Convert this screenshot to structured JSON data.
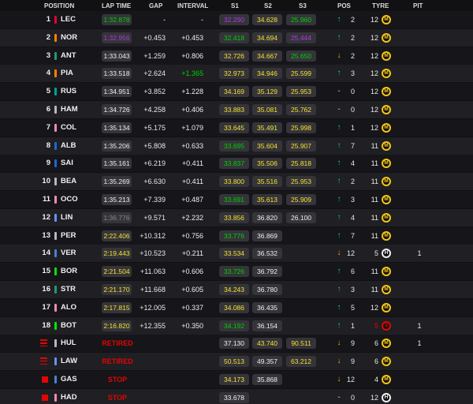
{
  "header": {
    "position": "POSITION",
    "lap_time": "LAP TIME",
    "gap": "GAP",
    "interval": "INTERVAL",
    "s1": "S1",
    "s2": "S2",
    "s3": "S3",
    "pos": "POS",
    "tyre": "TYRE",
    "pit": "PIT"
  },
  "colors": {
    "purple": "#b138dd",
    "green": "#00d000",
    "yellow": "#f5e02e",
    "white": "#f0f0f0",
    "grey": "#8a8a8a",
    "red": "#e10600",
    "arrow_up": "#22c55e",
    "arrow_down": "#f5a623"
  },
  "rows": [
    {
      "pos": "1",
      "status_icon": "",
      "team_color": "#e8002d",
      "code": "LEC",
      "lap_time": "1:32.878",
      "lap_color": "green",
      "status": "",
      "gap": "-",
      "interval": "-",
      "interval_color": "white",
      "s1": "32.290",
      "s1c": "purple",
      "s2": "34.628",
      "s2c": "yellow",
      "s3": "25.960",
      "s3c": "green",
      "arrow": "up",
      "pos_change": "2",
      "tyre_age": "12",
      "tyre_compound": "M",
      "tyre_color": "#f5c518",
      "pit": ""
    },
    {
      "pos": "2",
      "status_icon": "",
      "team_color": "#ff8000",
      "code": "NOR",
      "lap_time": "1:32.956",
      "lap_color": "purple",
      "status": "",
      "gap": "+0.453",
      "interval": "+0.453",
      "interval_color": "white",
      "s1": "32.418",
      "s1c": "green",
      "s2": "34.694",
      "s2c": "yellow",
      "s3": "25.444",
      "s3c": "purple",
      "arrow": "up",
      "pos_change": "2",
      "tyre_age": "12",
      "tyre_compound": "M",
      "tyre_color": "#f5c518",
      "pit": ""
    },
    {
      "pos": "3",
      "status_icon": "",
      "team_color": "#229971",
      "code": "ANT",
      "lap_time": "1:33.043",
      "lap_color": "white",
      "status": "",
      "gap": "+1.259",
      "interval": "+0.806",
      "interval_color": "white",
      "s1": "32.726",
      "s1c": "yellow",
      "s2": "34.667",
      "s2c": "yellow",
      "s3": "25.650",
      "s3c": "green",
      "arrow": "down",
      "pos_change": "2",
      "tyre_age": "12",
      "tyre_compound": "M",
      "tyre_color": "#f5c518",
      "pit": ""
    },
    {
      "pos": "4",
      "status_icon": "",
      "team_color": "#ff8000",
      "code": "PIA",
      "lap_time": "1:33.518",
      "lap_color": "white",
      "status": "",
      "gap": "+2.624",
      "interval": "+1.365",
      "interval_color": "green",
      "s1": "32.973",
      "s1c": "yellow",
      "s2": "34.946",
      "s2c": "yellow",
      "s3": "25.599",
      "s3c": "yellow",
      "arrow": "up",
      "pos_change": "3",
      "tyre_age": "12",
      "tyre_compound": "M",
      "tyre_color": "#f5c518",
      "pit": ""
    },
    {
      "pos": "5",
      "status_icon": "",
      "team_color": "#00a19c",
      "code": "RUS",
      "lap_time": "1:34.951",
      "lap_color": "white",
      "status": "",
      "gap": "+3.852",
      "interval": "+1.228",
      "interval_color": "white",
      "s1": "34.169",
      "s1c": "yellow",
      "s2": "35.129",
      "s2c": "yellow",
      "s3": "25.953",
      "s3c": "yellow",
      "arrow": "same",
      "pos_change": "0",
      "tyre_age": "12",
      "tyre_compound": "M",
      "tyre_color": "#f5c518",
      "pit": ""
    },
    {
      "pos": "6",
      "status_icon": "",
      "team_color": "#b6babd",
      "code": "HAM",
      "lap_time": "1:34.726",
      "lap_color": "white",
      "status": "",
      "gap": "+4.258",
      "interval": "+0.406",
      "interval_color": "white",
      "s1": "33.883",
      "s1c": "yellow",
      "s2": "35.081",
      "s2c": "yellow",
      "s3": "25.762",
      "s3c": "yellow",
      "arrow": "same",
      "pos_change": "0",
      "tyre_age": "12",
      "tyre_compound": "M",
      "tyre_color": "#f5c518",
      "pit": ""
    },
    {
      "pos": "7",
      "status_icon": "",
      "team_color": "#ff87bc",
      "code": "COL",
      "lap_time": "1:35.134",
      "lap_color": "white",
      "status": "",
      "gap": "+5.175",
      "interval": "+1.079",
      "interval_color": "white",
      "s1": "33.645",
      "s1c": "yellow",
      "s2": "35.491",
      "s2c": "yellow",
      "s3": "25.998",
      "s3c": "yellow",
      "arrow": "up",
      "pos_change": "1",
      "tyre_age": "12",
      "tyre_compound": "M",
      "tyre_color": "#f5c518",
      "pit": ""
    },
    {
      "pos": "8",
      "status_icon": "",
      "team_color": "#1868db",
      "code": "ALB",
      "lap_time": "1:35.206",
      "lap_color": "white",
      "status": "",
      "gap": "+5.808",
      "interval": "+0.633",
      "interval_color": "white",
      "s1": "33.695",
      "s1c": "green",
      "s2": "35.604",
      "s2c": "yellow",
      "s3": "25.907",
      "s3c": "yellow",
      "arrow": "up",
      "pos_change": "7",
      "tyre_age": "11",
      "tyre_compound": "M",
      "tyre_color": "#f5c518",
      "pit": ""
    },
    {
      "pos": "9",
      "status_icon": "",
      "team_color": "#1868db",
      "code": "SAI",
      "lap_time": "1:35.161",
      "lap_color": "white",
      "status": "",
      "gap": "+6.219",
      "interval": "+0.411",
      "interval_color": "white",
      "s1": "33.837",
      "s1c": "green",
      "s2": "35.506",
      "s2c": "yellow",
      "s3": "25.818",
      "s3c": "yellow",
      "arrow": "up",
      "pos_change": "4",
      "tyre_age": "11",
      "tyre_compound": "M",
      "tyre_color": "#f5c518",
      "pit": ""
    },
    {
      "pos": "10",
      "status_icon": "",
      "team_color": "#b6babd",
      "code": "BEA",
      "lap_time": "1:35.269",
      "lap_color": "white",
      "status": "",
      "gap": "+6.630",
      "interval": "+0.411",
      "interval_color": "white",
      "s1": "33.800",
      "s1c": "yellow",
      "s2": "35.516",
      "s2c": "yellow",
      "s3": "25.953",
      "s3c": "yellow",
      "arrow": "up",
      "pos_change": "2",
      "tyre_age": "11",
      "tyre_compound": "M",
      "tyre_color": "#f5c518",
      "pit": ""
    },
    {
      "pos": "11",
      "status_icon": "",
      "team_color": "#ff87bc",
      "code": "OCO",
      "lap_time": "1:35.213",
      "lap_color": "white",
      "status": "",
      "gap": "+7.339",
      "interval": "+0.487",
      "interval_color": "white",
      "s1": "33.691",
      "s1c": "green",
      "s2": "35.613",
      "s2c": "yellow",
      "s3": "25.909",
      "s3c": "yellow",
      "arrow": "up",
      "pos_change": "3",
      "tyre_age": "11",
      "tyre_compound": "M",
      "tyre_color": "#f5c518",
      "pit": ""
    },
    {
      "pos": "12",
      "status_icon": "",
      "team_color": "#6692ff",
      "code": "LIN",
      "lap_time": "1:36.776",
      "lap_color": "grey",
      "status": "",
      "gap": "+9.571",
      "interval": "+2.232",
      "interval_color": "white",
      "s1": "33.856",
      "s1c": "yellow",
      "s2": "36.820",
      "s2c": "white",
      "s3": "26.100",
      "s3c": "white",
      "arrow": "up",
      "pos_change": "4",
      "tyre_age": "11",
      "tyre_compound": "M",
      "tyre_color": "#f5c518",
      "pit": ""
    },
    {
      "pos": "13",
      "status_icon": "",
      "team_color": "#b6babd",
      "code": "PER",
      "lap_time": "2:22.406",
      "lap_color": "yellow",
      "status": "",
      "gap": "+10.312",
      "interval": "+0.756",
      "interval_color": "white",
      "s1": "33.776",
      "s1c": "green",
      "s2": "36.869",
      "s2c": "white",
      "s3": "",
      "s3c": "white",
      "arrow": "up",
      "pos_change": "7",
      "tyre_age": "11",
      "tyre_compound": "M",
      "tyre_color": "#f5c518",
      "pit": ""
    },
    {
      "pos": "14",
      "status_icon": "",
      "team_color": "#4781d7",
      "code": "VER",
      "lap_time": "2:19.443",
      "lap_color": "yellow",
      "status": "",
      "gap": "+10.523",
      "interval": "+0.211",
      "interval_color": "white",
      "s1": "33.534",
      "s1c": "yellow",
      "s2": "36.532",
      "s2c": "white",
      "s3": "",
      "s3c": "white",
      "arrow": "down",
      "pos_change": "12",
      "tyre_age": "5",
      "tyre_compound": "H",
      "tyre_color": "#f0f0f0",
      "pit": "1"
    },
    {
      "pos": "15",
      "status_icon": "",
      "team_color": "#00e701",
      "code": "BOR",
      "lap_time": "2:21.504",
      "lap_color": "yellow",
      "status": "",
      "gap": "+11.063",
      "interval": "+0.606",
      "interval_color": "white",
      "s1": "33.726",
      "s1c": "green",
      "s2": "36.792",
      "s2c": "white",
      "s3": "",
      "s3c": "white",
      "arrow": "up",
      "pos_change": "6",
      "tyre_age": "11",
      "tyre_compound": "M",
      "tyre_color": "#f5c518",
      "pit": ""
    },
    {
      "pos": "16",
      "status_icon": "",
      "team_color": "#229971",
      "code": "STR",
      "lap_time": "2:21.170",
      "lap_color": "yellow",
      "status": "",
      "gap": "+11.668",
      "interval": "+0.605",
      "interval_color": "white",
      "s1": "34.243",
      "s1c": "yellow",
      "s2": "36.780",
      "s2c": "white",
      "s3": "",
      "s3c": "white",
      "arrow": "up",
      "pos_change": "3",
      "tyre_age": "11",
      "tyre_compound": "M",
      "tyre_color": "#f5c518",
      "pit": ""
    },
    {
      "pos": "17",
      "status_icon": "",
      "team_color": "#ff87bc",
      "code": "ALO",
      "lap_time": "2:17.815",
      "lap_color": "yellow",
      "status": "",
      "gap": "+12.005",
      "interval": "+0.337",
      "interval_color": "white",
      "s1": "34.086",
      "s1c": "yellow",
      "s2": "36.435",
      "s2c": "white",
      "s3": "",
      "s3c": "white",
      "arrow": "up",
      "pos_change": "5",
      "tyre_age": "12",
      "tyre_compound": "M",
      "tyre_color": "#f5c518",
      "pit": ""
    },
    {
      "pos": "18",
      "status_icon": "",
      "team_color": "#00e701",
      "code": "BOT",
      "lap_time": "2:16.820",
      "lap_color": "yellow",
      "status": "",
      "gap": "+12.355",
      "interval": "+0.350",
      "interval_color": "white",
      "s1": "34.192",
      "s1c": "green",
      "s2": "36.154",
      "s2c": "white",
      "s3": "",
      "s3c": "white",
      "arrow": "up",
      "pos_change": "1",
      "tyre_age": "5",
      "tyre_compound": "S",
      "tyre_color": "#e10600",
      "tyre_age_color": "#e10600",
      "pit": "1"
    },
    {
      "pos": "",
      "status_icon": "lines",
      "team_color": "#b6babd",
      "code": "HUL",
      "lap_time": "",
      "lap_color": "white",
      "status": "RETIRED",
      "gap": "",
      "interval": "",
      "interval_color": "white",
      "s1": "37.130",
      "s1c": "white",
      "s2": "43.740",
      "s2c": "yellow",
      "s3": "90.511",
      "s3c": "yellow",
      "arrow": "down",
      "pos_change": "9",
      "tyre_age": "6",
      "tyre_compound": "M",
      "tyre_color": "#f5c518",
      "pit": "1"
    },
    {
      "pos": "",
      "status_icon": "lines",
      "team_color": "#6692ff",
      "code": "LAW",
      "lap_time": "",
      "lap_color": "white",
      "status": "RETIRED",
      "gap": "",
      "interval": "",
      "interval_color": "white",
      "s1": "50.513",
      "s1c": "yellow",
      "s2": "49.357",
      "s2c": "white",
      "s3": "63.212",
      "s3c": "yellow",
      "arrow": "down",
      "pos_change": "9",
      "tyre_age": "6",
      "tyre_compound": "M",
      "tyre_color": "#f5c518",
      "pit": ""
    },
    {
      "pos": "",
      "status_icon": "square",
      "team_color": "#4781d7",
      "code": "GAS",
      "lap_time": "",
      "lap_color": "white",
      "status": "STOP",
      "gap": "",
      "interval": "",
      "interval_color": "white",
      "s1": "34.173",
      "s1c": "yellow",
      "s2": "35.868",
      "s2c": "white",
      "s3": "",
      "s3c": "white",
      "arrow": "down",
      "pos_change": "12",
      "tyre_age": "4",
      "tyre_compound": "M",
      "tyre_color": "#f5c518",
      "pit": ""
    },
    {
      "pos": "",
      "status_icon": "square",
      "team_color": "#ff87bc",
      "code": "HAD",
      "lap_time": "",
      "lap_color": "white",
      "status": "STOP",
      "gap": "",
      "interval": "",
      "interval_color": "white",
      "s1": "33.678",
      "s1c": "white",
      "s2": "",
      "s2c": "white",
      "s3": "",
      "s3c": "white",
      "arrow": "same",
      "pos_change": "0",
      "tyre_age": "12",
      "tyre_compound": "H",
      "tyre_color": "#f0f0f0",
      "pit": ""
    }
  ]
}
